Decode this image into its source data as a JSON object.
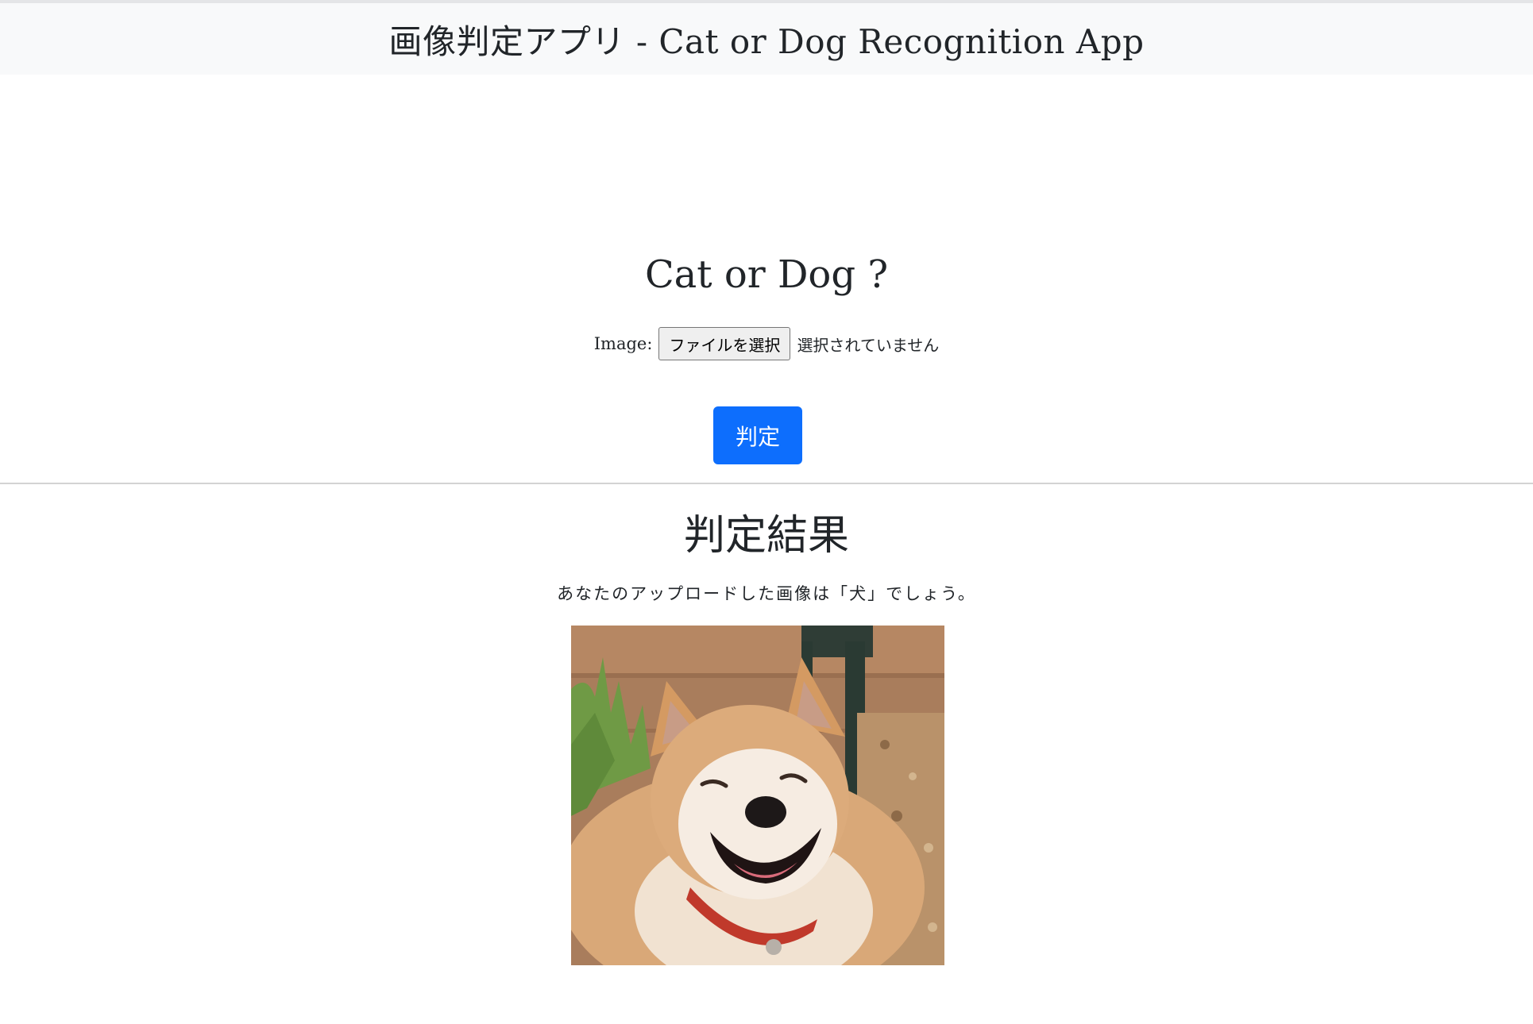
{
  "navbar": {
    "title": "画像判定アプリ - Cat or Dog Recognition App"
  },
  "upload": {
    "heading": "Cat or Dog ?",
    "image_label": "Image:",
    "file_button_label": "ファイルを選択",
    "file_status": "選択されていません",
    "submit_label": "判定"
  },
  "result": {
    "heading": "判定結果",
    "message": "あなたのアップロードした画像は「犬」でしょう。"
  },
  "colors": {
    "navbar_bg": "#f8f9fa",
    "primary": "#0d6efd",
    "text": "#212529",
    "divider": "#d3d3d3"
  }
}
